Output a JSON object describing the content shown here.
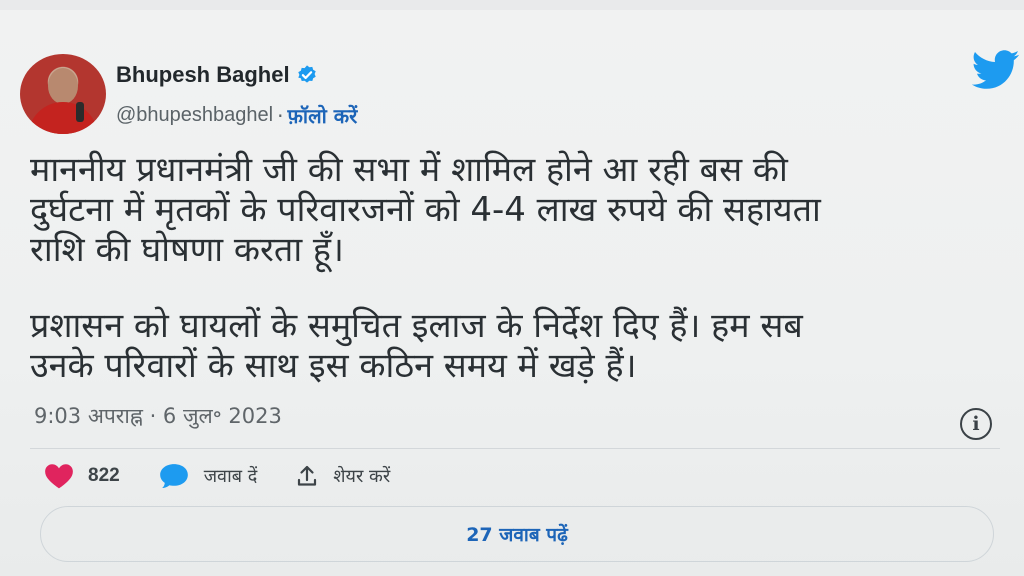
{
  "author": {
    "name": "Bhupesh Baghel",
    "handle": "@bhupeshbaghel",
    "separator": "·",
    "follow_label": "फ़ॉलो करें"
  },
  "tweet": {
    "paragraphs": [
      "माननीय प्रधानमंत्री जी की सभा में शामिल होने आ रही बस की\nदुर्घटना में मृतकों के परिवारजनों को 4-4 लाख रुपये की सहायता\nराशि की घोषणा करता हूँ।",
      "प्रशासन को घायलों के समुचित इलाज के निर्देश दिए हैं। हम सब\nउनके परिवारों के साथ इस कठिन समय में खड़े हैं।"
    ],
    "timestamp": "9:03 अपराह्न · 6 जुल॰ 2023"
  },
  "actions": {
    "like_count": "822",
    "reply_label": "जवाब दें",
    "share_label": "शेयर करें"
  },
  "replies_button": "27 जवाब पढ़ें",
  "icons": {
    "verified": "verified-badge-icon",
    "brand": "twitter-bird-icon",
    "info": "info-icon",
    "like": "heart-icon",
    "reply": "speech-bubble-icon",
    "share": "share-upload-icon"
  },
  "colors": {
    "brand": "#1d9bf0",
    "link": "#1d65b8",
    "like": "#e0245e"
  }
}
